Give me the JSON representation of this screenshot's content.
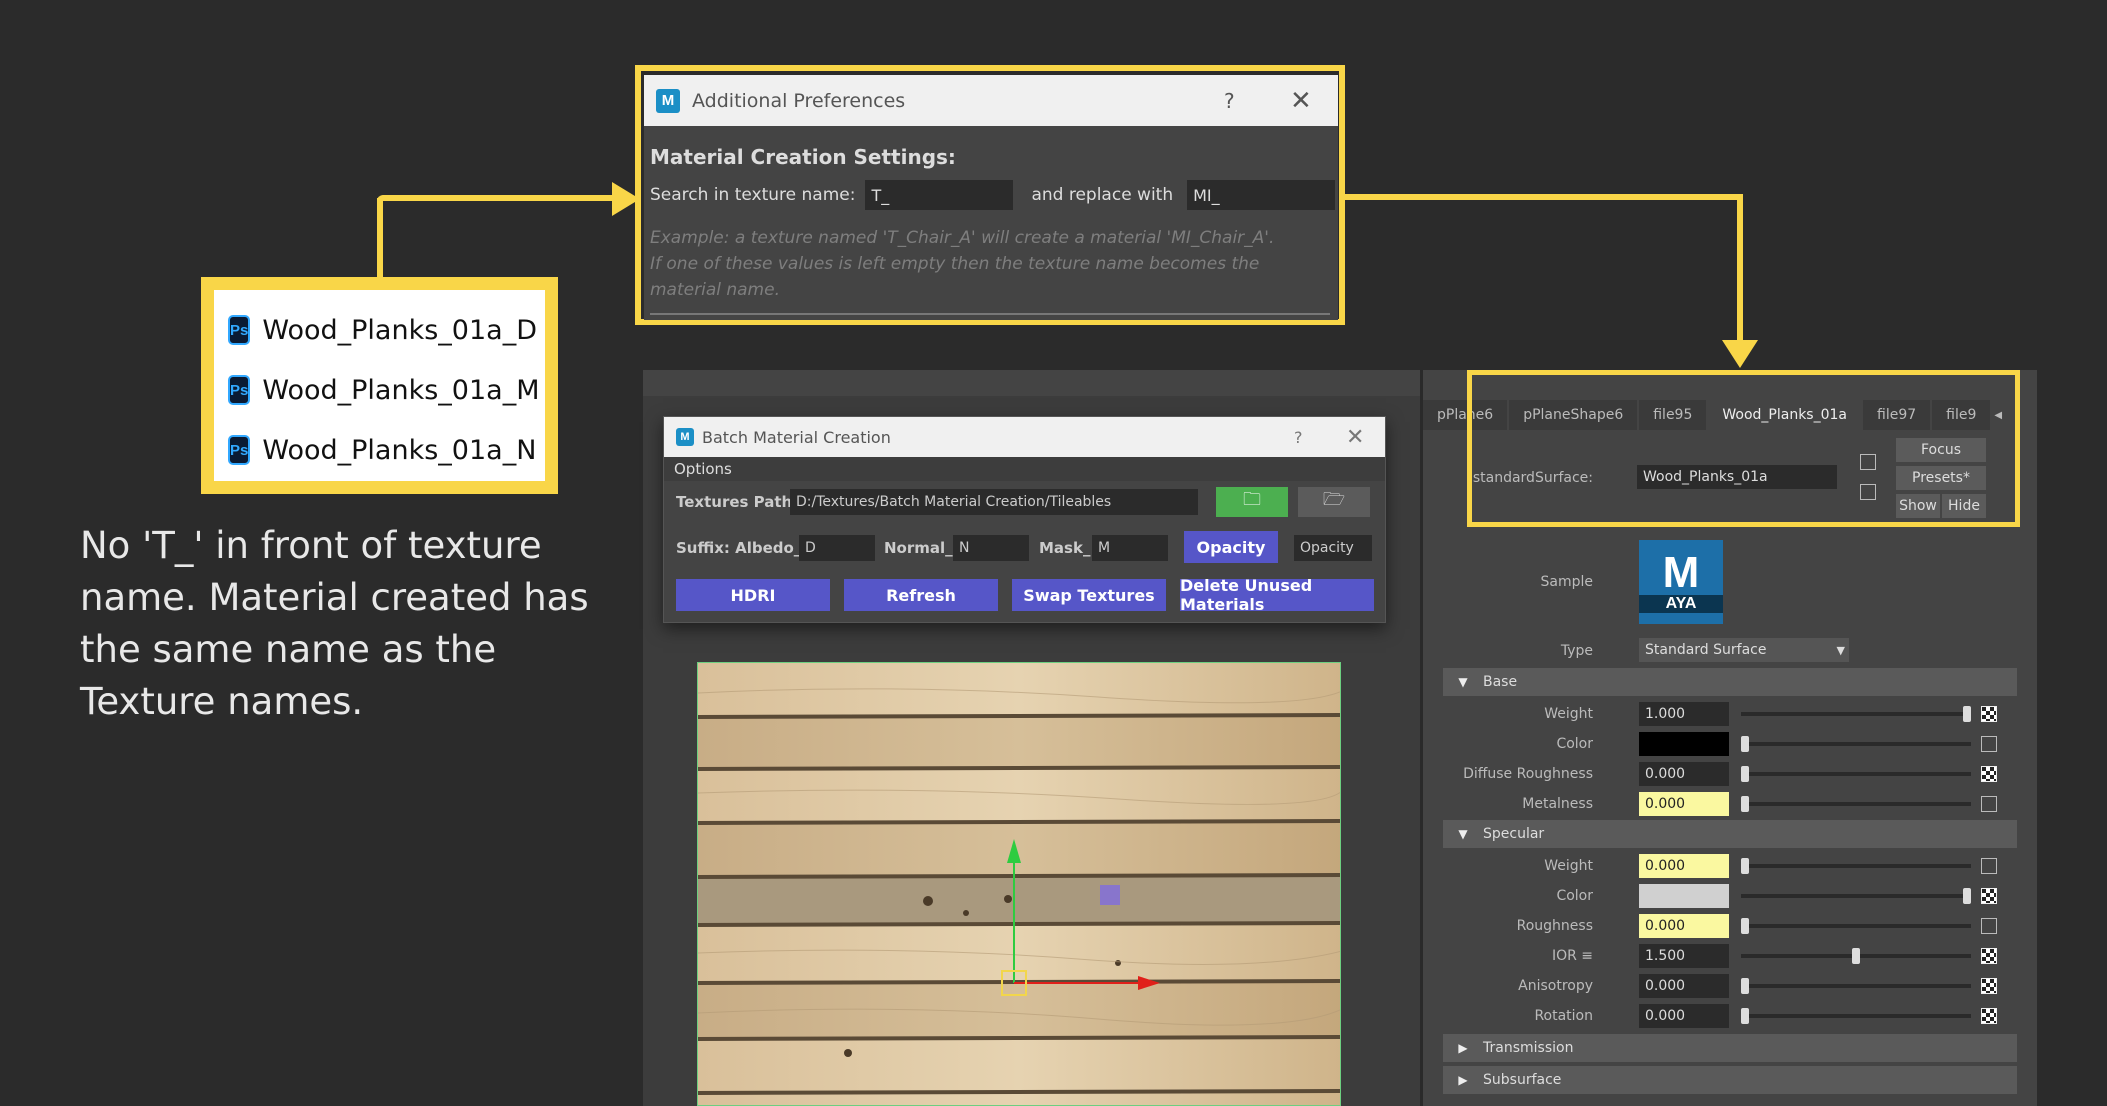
{
  "files": [
    {
      "icon": "photoshop-icon",
      "name": "Wood_Planks_01a_D"
    },
    {
      "icon": "photoshop-icon",
      "name": "Wood_Planks_01a_M"
    },
    {
      "icon": "photoshop-icon",
      "name": "Wood_Planks_01a_N"
    }
  ],
  "note": "No 'T_' in front of texture name. Material created has the same name as the Texture names.",
  "preferences": {
    "title": "Additional Preferences",
    "help": "?",
    "heading": "Material Creation Settings:",
    "search_label": "Search in texture name:",
    "search_value": "T_",
    "replace_label": "and replace with",
    "replace_value": "MI_",
    "example_line1": "Example: a texture named 'T_Chair_A' will create a material 'MI_Chair_A'.",
    "example_line2": "If one of these values is left empty then the texture name becomes the material name."
  },
  "batch": {
    "title": "Batch Material Creation",
    "help": "?",
    "options": "Options",
    "path_label": "Textures Path:",
    "path_value": "D:/Textures/Batch Material Creation/Tileables",
    "suffix_label": "Suffix: Albedo_",
    "albedo_value": "D",
    "normal_label": "Normal_",
    "normal_value": "N",
    "mask_label": "Mask_",
    "mask_value": "M",
    "opacity_button": "Opacity",
    "opacity_value": "Opacity",
    "buttons": [
      "HDRI",
      "Refresh",
      "Swap Textures",
      "Delete Unused Materials"
    ]
  },
  "attribute_editor": {
    "tabs": [
      "pPlane6",
      "pPlaneShape6",
      "file95",
      "Wood_Planks_01a",
      "file97",
      "file9"
    ],
    "active_tab": 3,
    "surface_label": "standardSurface:",
    "surface_value": "Wood_Planks_01a",
    "focus": "Focus",
    "presets": "Presets*",
    "show": "Show",
    "hide": "Hide",
    "sample_label": "Sample",
    "sample_logo_letter": "M",
    "sample_logo_text": "AYA",
    "type_label": "Type",
    "type_value": "Standard Surface",
    "sections": {
      "base": "Base",
      "specular": "Specular",
      "transmission": "Transmission",
      "subsurface": "Subsurface"
    },
    "base_rows": [
      {
        "label": "Weight",
        "value": "1.000",
        "level": 1.0,
        "highlight": false,
        "checker": true
      },
      {
        "label": "Color",
        "value": "",
        "swatch": "#000000",
        "level": 0.0,
        "checker": false
      },
      {
        "label": "Diffuse Roughness",
        "value": "0.000",
        "level": 0.0,
        "highlight": false,
        "checker": true
      },
      {
        "label": "Metalness",
        "value": "0.000",
        "level": 0.0,
        "highlight": true,
        "checker": false
      }
    ],
    "specular_rows": [
      {
        "label": "Weight",
        "value": "0.000",
        "level": 0.0,
        "highlight": true,
        "checker": false
      },
      {
        "label": "Color",
        "value": "",
        "swatch": "#d0d0d0",
        "level": 1.0,
        "checker": true
      },
      {
        "label": "Roughness",
        "value": "0.000",
        "level": 0.0,
        "highlight": true,
        "checker": false
      },
      {
        "label": "IOR ≡",
        "value": "1.500",
        "level": 0.5,
        "highlight": false,
        "checker": true
      },
      {
        "label": "Anisotropy",
        "value": "0.000",
        "level": 0.0,
        "highlight": false,
        "checker": true
      },
      {
        "label": "Rotation",
        "value": "0.000",
        "level": 0.0,
        "highlight": false,
        "checker": true
      }
    ]
  },
  "colors": {
    "highlight_frame": "#f9d648",
    "button_purple": "#5656c8",
    "button_green": "#4caf50"
  }
}
